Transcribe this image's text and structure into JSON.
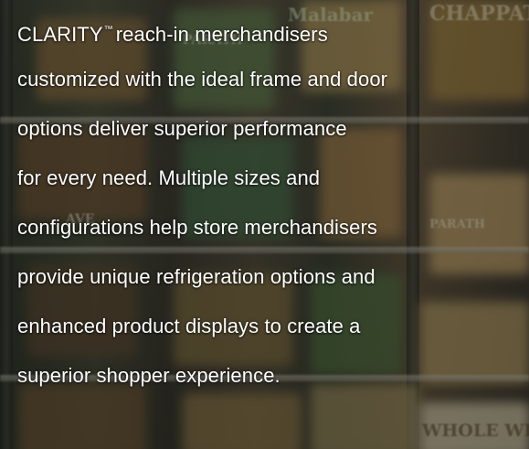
{
  "copy": {
    "lines": [
      "CLARITY",
      "customized with the ideal frame and door",
      "options deliver superior performance",
      "for every need. Multiple sizes and",
      "configurations help store merchandisers",
      "provide unique refrigeration options and",
      "enhanced product displays to create a",
      "superior shopper experience."
    ],
    "trademark": "™",
    "line1_rest": "reach-in merchandisers"
  },
  "background": {
    "packaging_texts": [
      "CHAPPAT",
      "PARATH",
      "Malabar",
      "WHOLE WHE",
      "AVE",
      "PARATH"
    ]
  }
}
